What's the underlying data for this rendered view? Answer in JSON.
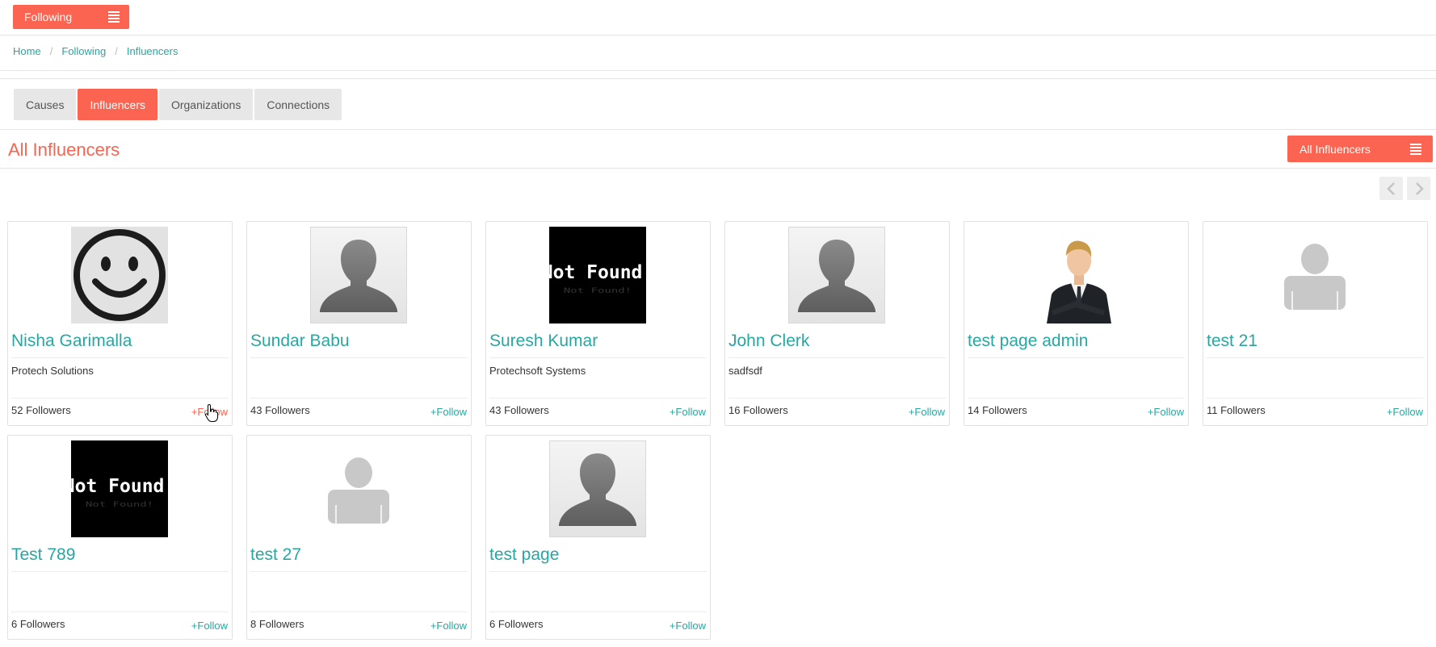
{
  "topbar": {
    "following_label": "Following",
    "menu_icon": "hamburger-icon"
  },
  "breadcrumb": {
    "items": [
      "Home",
      "Following",
      "Influencers"
    ],
    "separator": "/"
  },
  "tabs": [
    {
      "label": "Causes",
      "active": false
    },
    {
      "label": "Influencers",
      "active": true
    },
    {
      "label": "Organizations",
      "active": false
    },
    {
      "label": "Connections",
      "active": false
    }
  ],
  "section": {
    "title": "All Influencers",
    "filter_label": "All Influencers"
  },
  "pager": {
    "prev_icon": "chevron-left-icon",
    "next_icon": "chevron-right-icon"
  },
  "colors": {
    "accent": "#fa6450",
    "link": "#27a7a0"
  },
  "cards": [
    {
      "name": "Nisha Garimalla",
      "org": "Protech Solutions",
      "followers": "52 Followers",
      "follow": "+Follow",
      "avatar": "smiley"
    },
    {
      "name": "Sundar Babu",
      "org": "",
      "followers": "43 Followers",
      "follow": "+Follow",
      "avatar": "silhouette"
    },
    {
      "name": "Suresh Kumar",
      "org": "Protechsoft Systems",
      "followers": "43 Followers",
      "follow": "+Follow",
      "avatar": "notfound"
    },
    {
      "name": "John Clerk",
      "org": "sadfsdf",
      "followers": "16 Followers",
      "follow": "+Follow",
      "avatar": "silhouette"
    },
    {
      "name": "test page admin",
      "org": "",
      "followers": "14 Followers",
      "follow": "+Follow",
      "avatar": "photo"
    },
    {
      "name": "test 21",
      "org": "",
      "followers": "11 Followers",
      "follow": "+Follow",
      "avatar": "placeholder"
    },
    {
      "name": "Test 789",
      "org": "",
      "followers": "6 Followers",
      "follow": "+Follow",
      "avatar": "notfound"
    },
    {
      "name": "test 27",
      "org": "",
      "followers": "8 Followers",
      "follow": "+Follow",
      "avatar": "placeholder"
    },
    {
      "name": "test page",
      "org": "",
      "followers": "6 Followers",
      "follow": "+Follow",
      "avatar": "silhouette"
    }
  ],
  "avatar_text": {
    "notfound": "Not Found!"
  }
}
